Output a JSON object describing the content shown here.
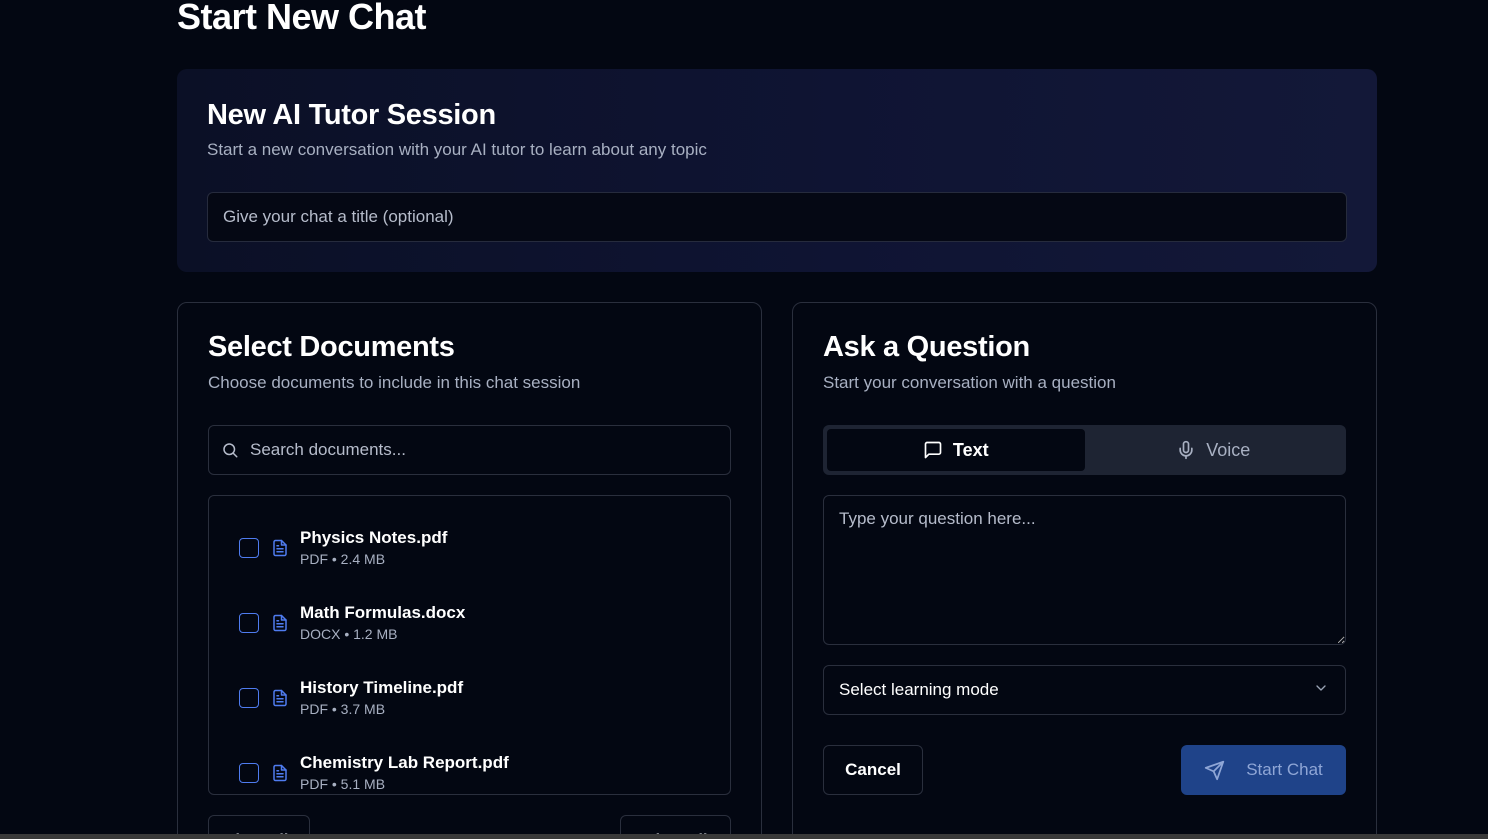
{
  "page": {
    "title": "Start New Chat"
  },
  "session": {
    "title": "New AI Tutor Session",
    "subtitle": "Start a new conversation with your AI tutor to learn about any topic",
    "title_input_placeholder": "Give your chat a title (optional)",
    "title_input_value": ""
  },
  "documents": {
    "title": "Select Documents",
    "subtitle": "Choose documents to include in this chat session",
    "search_placeholder": "Search documents...",
    "search_icon": "search-icon",
    "items": [
      {
        "name": "Physics Notes.pdf",
        "meta": "PDF • 2.4 MB",
        "checked": false,
        "icon": "file-text-icon"
      },
      {
        "name": "Math Formulas.docx",
        "meta": "DOCX • 1.2 MB",
        "checked": false,
        "icon": "file-text-icon"
      },
      {
        "name": "History Timeline.pdf",
        "meta": "PDF • 3.7 MB",
        "checked": false,
        "icon": "file-text-icon"
      },
      {
        "name": "Chemistry Lab Report.pdf",
        "meta": "PDF • 5.1 MB",
        "checked": false,
        "icon": "file-text-icon"
      }
    ],
    "clear_all_label": "Clear All",
    "select_all_label": "Select All"
  },
  "question": {
    "title": "Ask a Question",
    "subtitle": "Start your conversation with a question",
    "tabs": [
      {
        "label": "Text",
        "icon": "message-square-icon",
        "active": true
      },
      {
        "label": "Voice",
        "icon": "microphone-icon",
        "active": false
      }
    ],
    "textarea_placeholder": "Type your question here...",
    "textarea_value": "",
    "learning_mode_label": "Select learning mode",
    "cancel_label": "Cancel",
    "start_label": "Start Chat"
  },
  "colors": {
    "background": "#030712",
    "accent": "#4f7cf0",
    "start_button": "#1f4389",
    "border": "#2a2f3d"
  }
}
